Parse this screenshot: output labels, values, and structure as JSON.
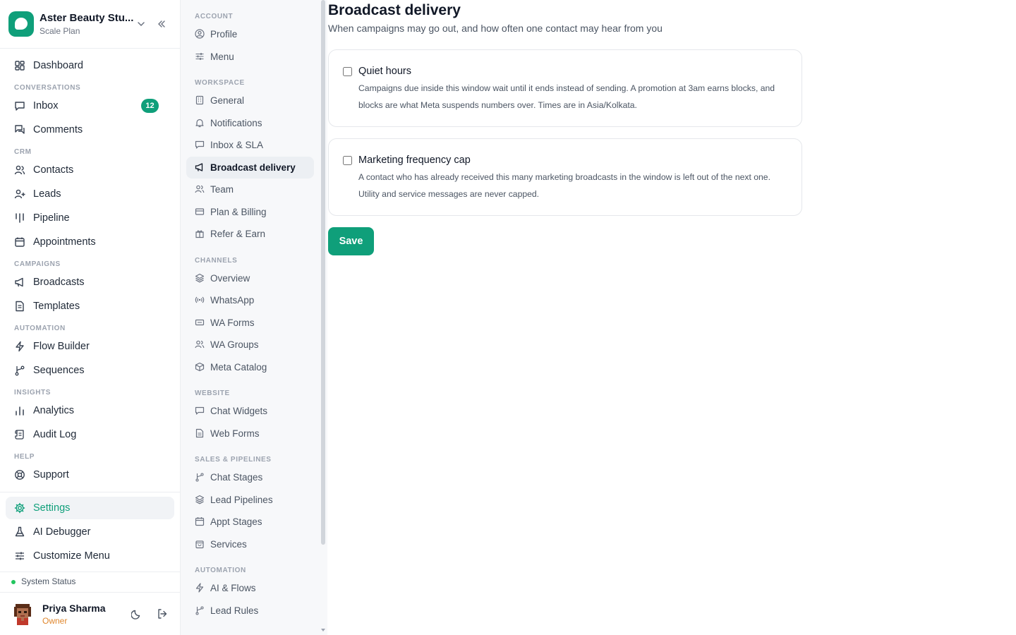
{
  "workspace": {
    "name": "Aster Beauty Stu...",
    "plan": "Scale Plan"
  },
  "sidebar": {
    "dashboard": "Dashboard",
    "sections": {
      "conversations": "CONVERSATIONS",
      "crm": "CRM",
      "campaigns": "CAMPAIGNS",
      "automation": "AUTOMATION",
      "insights": "INSIGHTS",
      "help": "HELP"
    },
    "inbox": "Inbox",
    "inbox_count": "12",
    "comments": "Comments",
    "contacts": "Contacts",
    "leads": "Leads",
    "pipeline": "Pipeline",
    "appointments": "Appointments",
    "broadcasts": "Broadcasts",
    "templates": "Templates",
    "flow_builder": "Flow Builder",
    "sequences": "Sequences",
    "analytics": "Analytics",
    "audit_log": "Audit Log",
    "support": "Support",
    "settings": "Settings",
    "ai_debugger": "AI Debugger",
    "customize_menu": "Customize Menu",
    "system_status": "System Status"
  },
  "user": {
    "name": "Priya Sharma",
    "role": "Owner"
  },
  "settings_nav": {
    "sections": {
      "account": "ACCOUNT",
      "workspace": "WORKSPACE",
      "channels": "CHANNELS",
      "website": "WEBSITE",
      "sales": "SALES & PIPELINES",
      "automation": "AUTOMATION"
    },
    "profile": "Profile",
    "menu": "Menu",
    "general": "General",
    "notifications": "Notifications",
    "inbox_sla": "Inbox & SLA",
    "broadcast_delivery": "Broadcast delivery",
    "team": "Team",
    "plan_billing": "Plan & Billing",
    "refer_earn": "Refer & Earn",
    "overview": "Overview",
    "whatsapp": "WhatsApp",
    "wa_forms": "WA Forms",
    "wa_groups": "WA Groups",
    "meta_catalog": "Meta Catalog",
    "chat_widgets": "Chat Widgets",
    "web_forms": "Web Forms",
    "chat_stages": "Chat Stages",
    "lead_pipelines": "Lead Pipelines",
    "appt_stages": "Appt Stages",
    "services": "Services",
    "ai_flows": "AI & Flows",
    "lead_rules": "Lead Rules"
  },
  "main": {
    "title": "Broadcast delivery",
    "subtitle": "When campaigns may go out, and how often one contact may hear from you",
    "quiet_hours": {
      "title": "Quiet hours",
      "checked": false,
      "description": "Campaigns due inside this window wait until it ends instead of sending. A promotion at 3am earns blocks, and blocks are what Meta suspends numbers over. Times are in Asia/Kolkata."
    },
    "frequency_cap": {
      "title": "Marketing frequency cap",
      "checked": false,
      "description": "A contact who has already received this many marketing broadcasts in the window is left out of the next one. Utility and service messages are never capped."
    },
    "save_label": "Save"
  },
  "colors": {
    "accent": "#0f9f7a",
    "role": "#e0872e",
    "status_ok": "#22c55e"
  }
}
